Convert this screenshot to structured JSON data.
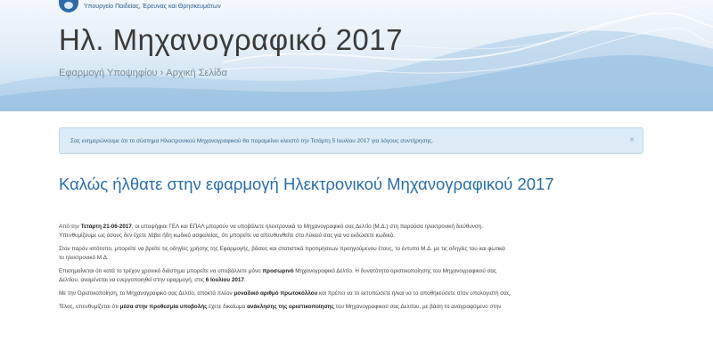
{
  "header": {
    "ministry": "Υπουργείο Παιδείας, Έρευνας και Θρησκευμάτων",
    "title": "Ηλ. Μηχανογραφικό 2017",
    "breadcrumb": [
      "Εφαρμογή Υποψηφίου",
      "Αρχική Σελίδα"
    ],
    "breadcrumb_separator": "›"
  },
  "alert": {
    "text": "Σας ενημερώνουμε ότι το σύστημα Ηλεκτρονικού Μηχανογραφικού θα παραμείνει κλειστό την Τετάρτη 5 Ιουλίου 2017 για λόγους συντήρησης.",
    "close": "×"
  },
  "main": {
    "welcome": "Καλώς ήλθατε στην εφαρμογή Ηλεκτρονικού Μηχανογραφικού 2017",
    "paragraphs": [
      {
        "lines": [
          [
            {
              "t": "Από την "
            },
            {
              "t": "Τετάρτη 21-06-2017",
              "b": true
            },
            {
              "t": ", οι υποψήφιοι ΓΕΛ και ΕΠΑΛ μπορούν να υποβάλετε ηλεκτρονικά το Μηχανογραφικό σας Δελτίο (Μ.Δ.) στη παρούσα ηλεκτρονική διεύθυνση."
            }
          ],
          [
            {
              "t": "Υπενθυμίζουμε ως όσους δεν έχετε λάβει ήδη κωδικό ασφαλείας, ότι μπορείτε να απευθυνθείτε στο Λύκειό σας για να εκδώσετε κωδικό."
            }
          ]
        ]
      },
      {
        "lines": [
          [
            {
              "t": "Στον παρόν ιστότοπο, μπορείτε να βρείτε τις οδηγίες χρήσης της Εφαρμογής, βάσεις και στατιστικά προτιμήσεων προηγούμενου έτους, το έντυπο Μ.Δ. με τις οδηγίες του και φωτικά"
            }
          ],
          [
            {
              "t": "το ηλεκτρονικό Μ.Δ."
            }
          ]
        ]
      },
      {
        "lines": [
          [
            {
              "t": "Επισημαίνεται ότι κατά το τρέχον χρονικό διάστημα μπορείτε να υποβάλλετε μόνο "
            },
            {
              "t": "προσωρινό",
              "b": true
            },
            {
              "t": " Μηχανογραφικό Δελτίο. Η δυνατότητα οριστικοποίησης του Μηχανογραφικού σας"
            }
          ],
          [
            {
              "t": "Δελτίου, αναμένεται να ενεργοποιηθεί στην εφαρμογή, στις "
            },
            {
              "t": "6 Ιουλίου 2017",
              "b": true
            },
            {
              "t": "."
            }
          ]
        ]
      },
      {
        "lines": [
          [
            {
              "t": "Με την Οριστικοποίηση, το Μηχανογραφικό σας Δελτίο, αποκτά πλέον "
            },
            {
              "t": "μοναδικό αριθμό πρωτοκόλλου",
              "b": true
            },
            {
              "t": " και πρέπει να το εκτυπώσετε ή/και να το αποθηκεύσετε στον υπολογιστή σας."
            }
          ]
        ]
      },
      {
        "lines": [
          [
            {
              "t": "Τέλος, υπενθυμίζεται ότι "
            },
            {
              "t": "μέσα στην προθεσμία υποβολής",
              "b": true
            },
            {
              "t": " έχετε δικαίωμα "
            },
            {
              "t": "ανάκλησης της οριστικοποίησης",
              "b": true
            },
            {
              "t": " του Μηχανογραφικού σας Δελτίου, με βάση το αναγραφόμενο στην"
            }
          ]
        ]
      }
    ]
  },
  "colors": {
    "title_blue": "#2a6fa8",
    "alert_bg": "#dcebf5",
    "alert_text": "#3b6a8f"
  }
}
